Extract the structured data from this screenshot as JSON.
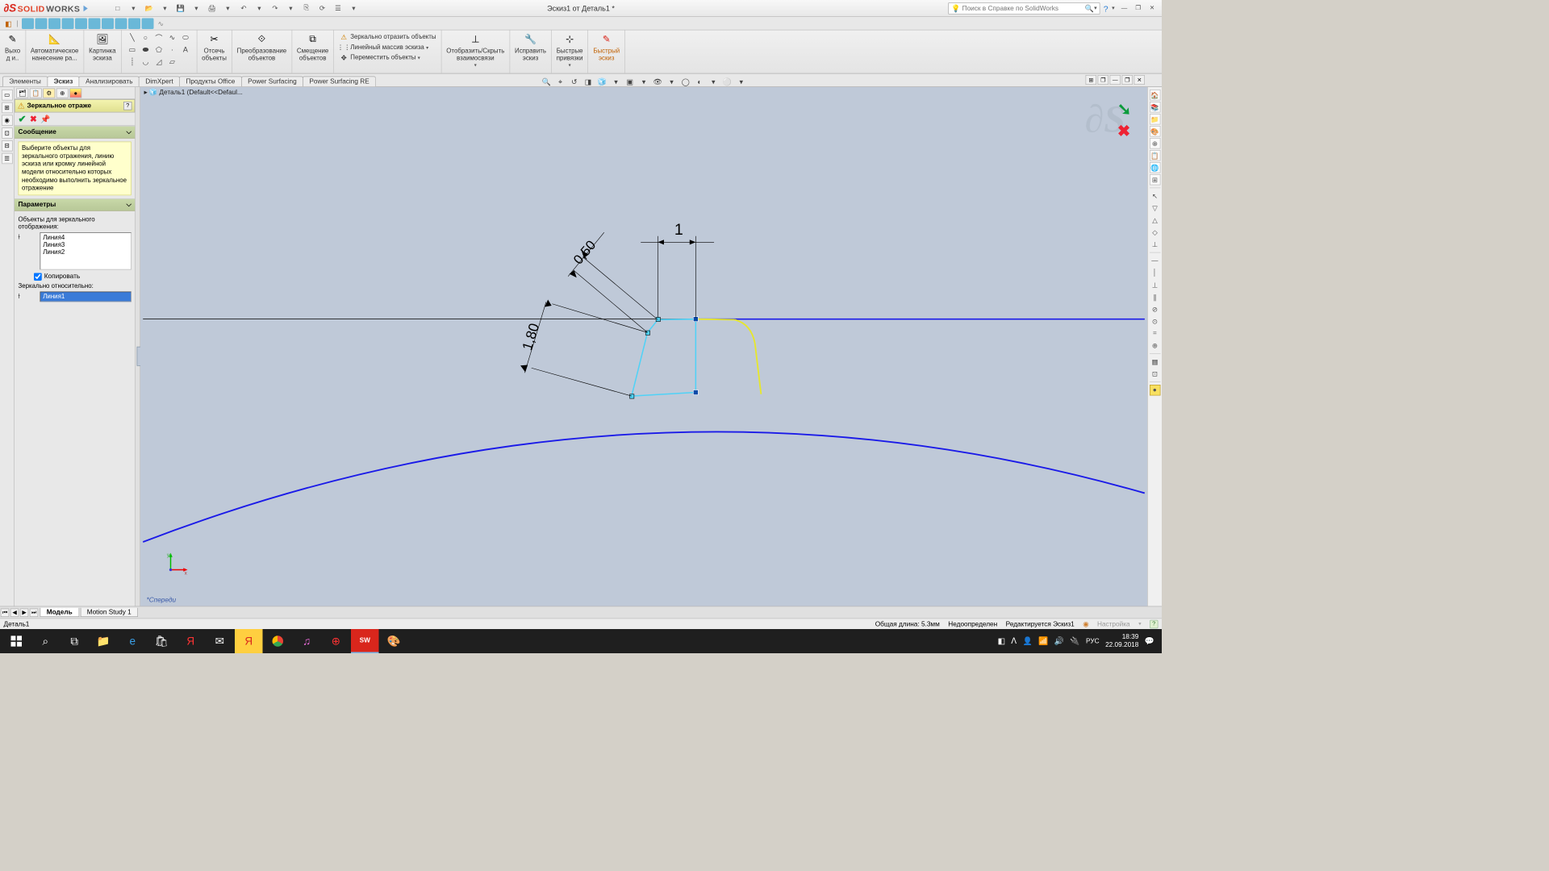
{
  "title": {
    "doc": "Эскиз1 от Деталь1 *"
  },
  "search": {
    "placeholder": "Поиск в Справке по SolidWorks"
  },
  "ribbon": {
    "exit": "Выхо\nд и..",
    "auto_dim": "Автоматическое\nнанесение ра...",
    "picture": "Картинка\nэскиза",
    "trim": "Отсечь\nобъекты",
    "convert": "Преобразование\nобъектов",
    "offset": "Смещение\nобъектов",
    "mirror": "Зеркально отразить объекты",
    "pattern": "Линейный массив эскиза",
    "move": "Переместить объекты",
    "relations": "Отобразить/Скрыть\nвзаимосвязи",
    "repair": "Исправить\nэскиз",
    "snaps": "Быстрые\nпривязки",
    "quick": "Быстрый\nэскиз"
  },
  "tabs": {
    "t1": "Элементы",
    "t2": "Эскиз",
    "t3": "Анализировать",
    "t4": "DimXpert",
    "t5": "Продукты Office",
    "t6": "Power Surfacing",
    "t7": "Power Surfacing RE"
  },
  "breadcrumb": {
    "part": "Деталь1  (Default<<Defaul..."
  },
  "pm": {
    "title": "Зеркальное отраже",
    "sec_msg": "Сообщение",
    "msg": "Выберите объекты для зеркального отражения, линию эскиза или кромку линейной модели относительно которых необходимо выполнить зеркальное отражение",
    "sec_param": "Параметры",
    "lbl_objects": "Объекты для зеркального отображения:",
    "items": {
      "i1": "Линия4",
      "i2": "Линия3",
      "i3": "Линия2"
    },
    "copy": "Копировать",
    "lbl_about": "Зеркально относительно:",
    "about_sel": "Линия1"
  },
  "dims": {
    "d1": "1",
    "d2": "0,50",
    "d3": "1,80"
  },
  "view": {
    "label": "*Спереди"
  },
  "triad": {
    "x": "x",
    "y": "y"
  },
  "bottom": {
    "model": "Модель",
    "motion": "Motion Study 1"
  },
  "status": {
    "part": "Деталь1",
    "length": "Общая длина: 5.3мм",
    "under": "Недоопределен",
    "editing": "Редактируется Эскиз1",
    "custom": "Настройка"
  },
  "tray": {
    "lang": "РУС",
    "time": "18:39",
    "date": "22.09.2018"
  }
}
